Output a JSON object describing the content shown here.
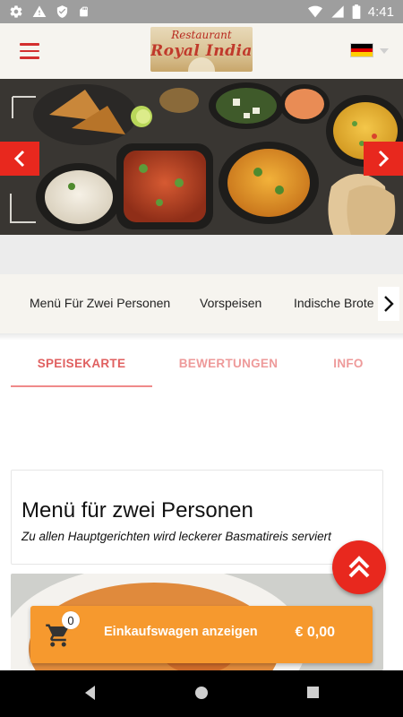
{
  "status_bar": {
    "time": "4:41",
    "icons": [
      "settings-icon",
      "warning-icon",
      "shield-icon",
      "sd-card-icon",
      "wifi-icon",
      "signal-icon",
      "battery-icon"
    ]
  },
  "header": {
    "logo_line1": "Restaurant",
    "logo_line2": "Royal India",
    "language_flag": "germany-flag-icon",
    "colors": {
      "accent": "#d32f2f",
      "header_bg": "#f6f4ef"
    }
  },
  "hero": {
    "prev_icon": "chevron-left-icon",
    "next_icon": "chevron-right-icon",
    "arrow_color": "#e8281e"
  },
  "categories": {
    "items": [
      "Menü Für Zwei Personen",
      "Vorspeisen",
      "Indische Brote"
    ],
    "more_icon": "chevron-right-icon"
  },
  "tabs": {
    "items": [
      "SPEISEKARTE",
      "BEWERTUNGEN",
      "INFO"
    ],
    "active": "SPEISEKARTE"
  },
  "section": {
    "title": "Menü für zwei Personen",
    "subtitle": "Zu allen Hauptgerichten wird leckerer Basmatireis serviert"
  },
  "cart": {
    "count": "0",
    "label": "Einkaufswagen anzeigen",
    "total": "€ 0,00",
    "color": "#f6992e"
  },
  "scroll_top": {
    "icon": "double-chevron-up-icon"
  },
  "nav_bar": {
    "buttons": [
      "back-icon",
      "home-icon",
      "recents-icon"
    ]
  }
}
